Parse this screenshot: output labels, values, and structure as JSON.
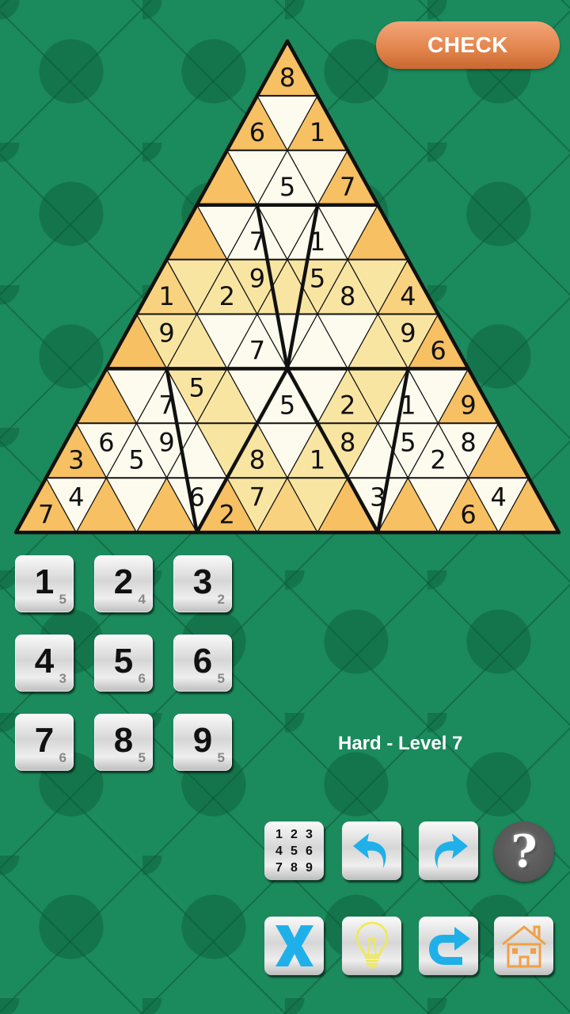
{
  "header": {
    "check_label": "CHECK"
  },
  "puzzle": {
    "difficulty": "Hard",
    "level": 7,
    "level_label": "Hard - Level 7",
    "colors": {
      "orange": "#f6c063",
      "light_orange": "#f8d27e",
      "yellow": "#f9e5a2",
      "cream": "#fdfbee",
      "line": "#111111"
    },
    "rows": [
      {
        "cells": [
          {
            "color": "orange",
            "value": "8"
          }
        ]
      },
      {
        "cells": [
          {
            "color": "orange",
            "value": "6"
          },
          {
            "color": "cream",
            "value": ""
          },
          {
            "color": "orange",
            "value": "1"
          }
        ]
      },
      {
        "cells": [
          {
            "color": "orange",
            "value": ""
          },
          {
            "color": "cream",
            "value": ""
          },
          {
            "color": "cream",
            "value": "5"
          },
          {
            "color": "cream",
            "value": ""
          },
          {
            "color": "orange",
            "value": "7"
          }
        ]
      },
      {
        "cells": [
          {
            "color": "orange",
            "value": ""
          },
          {
            "color": "cream",
            "value": ""
          },
          {
            "color": "cream",
            "value": "7"
          },
          {
            "color": "cream",
            "value": ""
          },
          {
            "color": "cream",
            "value": "1"
          },
          {
            "color": "cream",
            "value": ""
          },
          {
            "color": "orange",
            "value": ""
          }
        ]
      },
      {
        "cells": [
          {
            "color": "light_orange",
            "value": "1"
          },
          {
            "color": "yellow",
            "value": ""
          },
          {
            "color": "yellow",
            "value": "2"
          },
          {
            "color": "yellow",
            "value": "9"
          },
          {
            "color": "yellow",
            "value": ""
          },
          {
            "color": "yellow",
            "value": "5"
          },
          {
            "color": "yellow",
            "value": "8"
          },
          {
            "color": "yellow",
            "value": ""
          },
          {
            "color": "light_orange",
            "value": "4"
          }
        ]
      },
      {
        "cells": [
          {
            "color": "orange",
            "value": ""
          },
          {
            "color": "yellow",
            "value": "9"
          },
          {
            "color": "yellow",
            "value": ""
          },
          {
            "color": "cream",
            "value": ""
          },
          {
            "color": "cream",
            "value": "7"
          },
          {
            "color": "cream",
            "value": ""
          },
          {
            "color": "cream",
            "value": ""
          },
          {
            "color": "cream",
            "value": ""
          },
          {
            "color": "yellow",
            "value": ""
          },
          {
            "color": "yellow",
            "value": "9"
          },
          {
            "color": "orange",
            "value": "6"
          }
        ]
      },
      {
        "cells": [
          {
            "color": "orange",
            "value": ""
          },
          {
            "color": "cream",
            "value": ""
          },
          {
            "color": "cream",
            "value": "7"
          },
          {
            "color": "yellow",
            "value": "5"
          },
          {
            "color": "yellow",
            "value": ""
          },
          {
            "color": "cream",
            "value": ""
          },
          {
            "color": "cream",
            "value": "5"
          },
          {
            "color": "cream",
            "value": ""
          },
          {
            "color": "yellow",
            "value": "2"
          },
          {
            "color": "yellow",
            "value": ""
          },
          {
            "color": "cream",
            "value": "1"
          },
          {
            "color": "cream",
            "value": ""
          },
          {
            "color": "orange",
            "value": "9"
          }
        ]
      },
      {
        "cells": [
          {
            "color": "orange",
            "value": "3"
          },
          {
            "color": "cream",
            "value": "6"
          },
          {
            "color": "cream",
            "value": "5"
          },
          {
            "color": "cream",
            "value": "9"
          },
          {
            "color": "cream",
            "value": ""
          },
          {
            "color": "yellow",
            "value": ""
          },
          {
            "color": "yellow",
            "value": "8"
          },
          {
            "color": "cream",
            "value": ""
          },
          {
            "color": "yellow",
            "value": "1"
          },
          {
            "color": "yellow",
            "value": "8"
          },
          {
            "color": "cream",
            "value": ""
          },
          {
            "color": "cream",
            "value": "5"
          },
          {
            "color": "cream",
            "value": "2"
          },
          {
            "color": "cream",
            "value": "8"
          },
          {
            "color": "orange",
            "value": ""
          }
        ]
      },
      {
        "cells": [
          {
            "color": "orange",
            "value": "7"
          },
          {
            "color": "cream",
            "value": "4"
          },
          {
            "color": "orange",
            "value": ""
          },
          {
            "color": "cream",
            "value": ""
          },
          {
            "color": "orange",
            "value": ""
          },
          {
            "color": "cream",
            "value": "6"
          },
          {
            "color": "orange",
            "value": "2"
          },
          {
            "color": "yellow",
            "value": "7"
          },
          {
            "color": "light_orange",
            "value": ""
          },
          {
            "color": "yellow",
            "value": ""
          },
          {
            "color": "orange",
            "value": ""
          },
          {
            "color": "cream",
            "value": "3"
          },
          {
            "color": "orange",
            "value": ""
          },
          {
            "color": "cream",
            "value": ""
          },
          {
            "color": "orange",
            "value": "6"
          },
          {
            "color": "cream",
            "value": "4"
          },
          {
            "color": "orange",
            "value": ""
          }
        ]
      }
    ]
  },
  "numpad": [
    {
      "digit": "1",
      "remaining": "5"
    },
    {
      "digit": "2",
      "remaining": "4"
    },
    {
      "digit": "3",
      "remaining": "2"
    },
    {
      "digit": "4",
      "remaining": "3"
    },
    {
      "digit": "5",
      "remaining": "6"
    },
    {
      "digit": "6",
      "remaining": "5"
    },
    {
      "digit": "7",
      "remaining": "6"
    },
    {
      "digit": "8",
      "remaining": "5"
    },
    {
      "digit": "9",
      "remaining": "5"
    }
  ],
  "toolbar": {
    "notes_grid": [
      "1",
      "2",
      "3",
      "4",
      "5",
      "6",
      "7",
      "8",
      "9"
    ],
    "help_label": "?",
    "icons": {
      "notes": "number-grid-icon",
      "undo": "undo-arrow-icon",
      "redo": "redo-arrow-icon",
      "help": "question-mark-icon",
      "erase": "x-erase-icon",
      "hint": "lightbulb-icon",
      "restart": "restart-arrow-icon",
      "home": "house-icon"
    },
    "accent_blue": "#1fb0ea",
    "hint_yellow": "#f2ea4a",
    "home_orange": "#f0a046"
  }
}
